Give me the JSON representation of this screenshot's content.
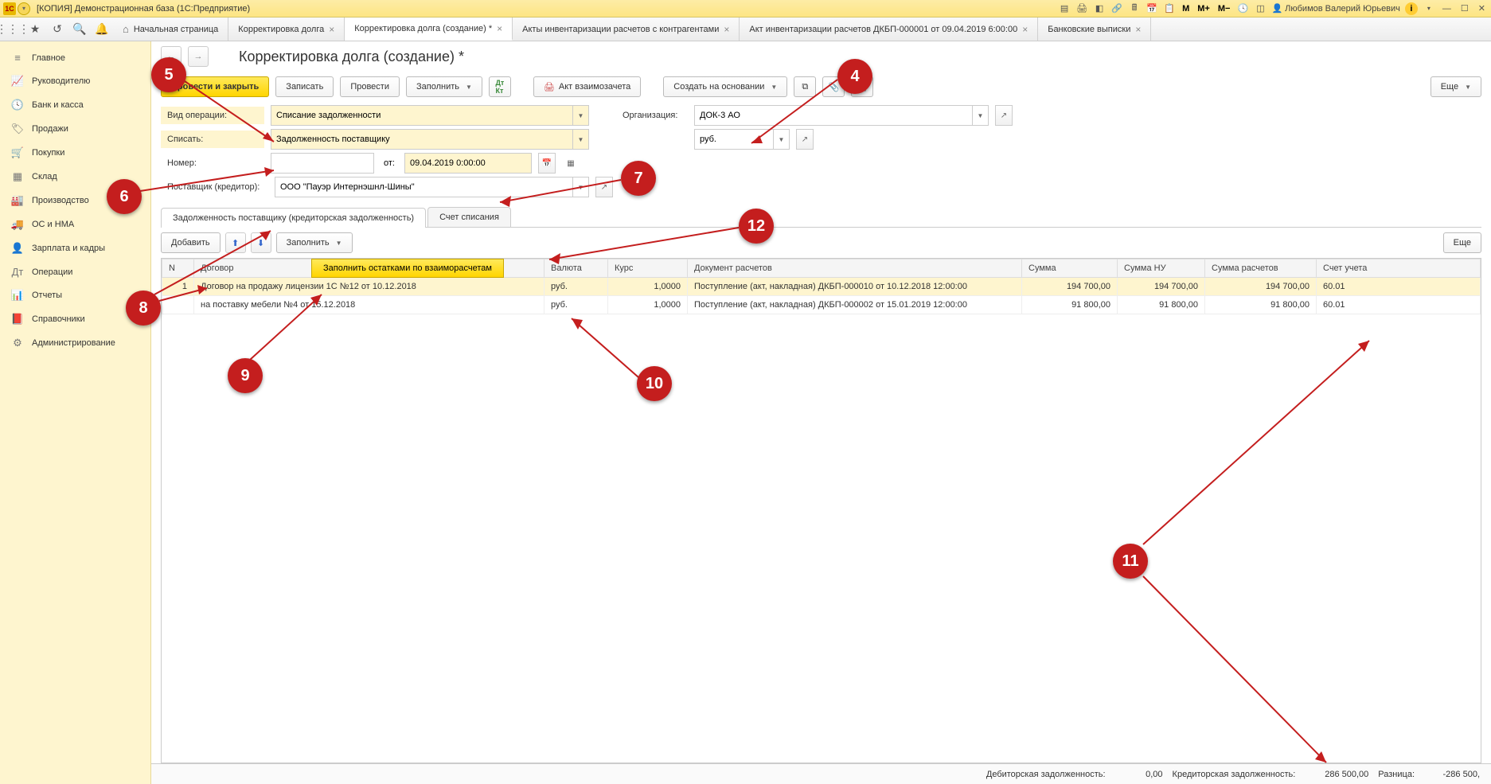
{
  "titlebar": {
    "title": "[КОПИЯ] Демонстрационная база  (1С:Предприятие)",
    "m": "M",
    "mplus": "M+",
    "mminus": "M−",
    "user": "Любимов Валерий Юрьевич"
  },
  "toptabs": {
    "home": "Начальная страница",
    "t1": "Корректировка долга",
    "t2": "Корректировка долга (создание) *",
    "t3": "Акты инвентаризации расчетов с контрагентами",
    "t4": "Акт инвентаризации расчетов ДКБП-000001 от 09.04.2019 6:00:00",
    "t5": "Банковские выписки"
  },
  "sidebar": {
    "items": [
      {
        "icon": "≡",
        "label": "Главное"
      },
      {
        "icon": "📈",
        "label": "Руководителю"
      },
      {
        "icon": "🕓",
        "label": "Банк и касса"
      },
      {
        "icon": "🏷",
        "label": "Продажи"
      },
      {
        "icon": "🛒",
        "label": "Покупки"
      },
      {
        "icon": "▦",
        "label": "Склад"
      },
      {
        "icon": "🏭",
        "label": "Производство"
      },
      {
        "icon": "🚚",
        "label": "ОС и НМА"
      },
      {
        "icon": "👤",
        "label": "Зарплата и кадры"
      },
      {
        "icon": "Дт",
        "label": "Операции"
      },
      {
        "icon": "📊",
        "label": "Отчеты"
      },
      {
        "icon": "📕",
        "label": "Справочники"
      },
      {
        "icon": "⚙",
        "label": "Администрирование"
      }
    ]
  },
  "page": {
    "title": "Корректировка долга (создание) *"
  },
  "cmd": {
    "post_close": "Провести и закрыть",
    "save": "Записать",
    "post": "Провести",
    "fill": "Заполнить",
    "akt": "Акт взаимозачета",
    "create_based": "Создать на основании",
    "more": "Еще"
  },
  "form": {
    "op_lbl": "Вид операции:",
    "op_val": "Списание задолженности",
    "writeoff_lbl": "Списать:",
    "writeoff_val": "Задолженность поставщику",
    "num_lbl": "Номер:",
    "num_val": "",
    "date_lbl": "от:",
    "date_val": "09.04.2019  0:00:00",
    "org_lbl": "Организация:",
    "org_val": "ДОК-3 АО",
    "cur_val": "руб.",
    "supplier_lbl": "Поставщик (кредитор):",
    "supplier_val": "ООО \"Пауэр Интернэшнл-Шины\""
  },
  "doctabs": {
    "t1": "Задолженность поставщику (кредиторская задолженность)",
    "t2": "Счет списания"
  },
  "tbar": {
    "add": "Добавить",
    "fill": "Заполнить",
    "fill_menu": "Заполнить остатками по взаиморасчетам",
    "more": "Еще"
  },
  "grid": {
    "headers": {
      "n": "N",
      "contract": "Договор",
      "currency": "Валюта",
      "rate": "Курс",
      "doc": "Документ расчетов",
      "sum": "Сумма",
      "sum_nu": "Сумма НУ",
      "sum_calc": "Сумма расчетов",
      "account": "Счет учета"
    },
    "rows": [
      {
        "n": "1",
        "contract": "Договор на продажу лицензии 1С №12 от 10.12.2018",
        "currency": "руб.",
        "rate": "1,0000",
        "doc": "Поступление (акт, накладная) ДКБП-000010 от 10.12.2018 12:00:00",
        "sum": "194 700,00",
        "sum_nu": "194 700,00",
        "sum_calc": "194 700,00",
        "account": "60.01"
      },
      {
        "n": "",
        "contract": "на поставку мебели №4 от 15.12.2018",
        "currency": "руб.",
        "rate": "1,0000",
        "doc": "Поступление (акт, накладная) ДКБП-000002 от 15.01.2019 12:00:00",
        "sum": "91 800,00",
        "sum_nu": "91 800,00",
        "sum_calc": "91 800,00",
        "account": "60.01"
      }
    ]
  },
  "status": {
    "debit_lbl": "Дебиторская задолженность:",
    "debit_val": "0,00",
    "credit_lbl": "Кредиторская задолженность:",
    "credit_val": "286 500,00",
    "diff_lbl": "Разница:",
    "diff_val": "-286 500,"
  },
  "callouts": {
    "4": "4",
    "5": "5",
    "6": "6",
    "7": "7",
    "8": "8",
    "9": "9",
    "10": "10",
    "11": "11",
    "12": "12"
  }
}
